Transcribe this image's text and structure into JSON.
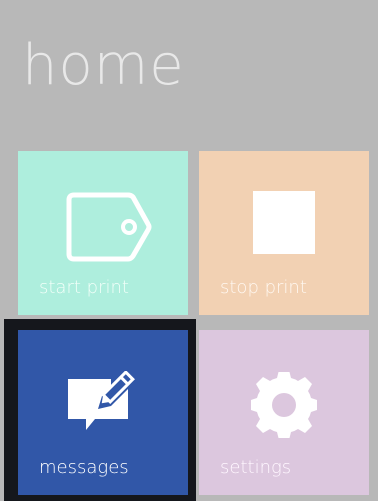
{
  "header": {
    "title": "home"
  },
  "tiles": [
    {
      "id": "start",
      "label": "start print",
      "icon": "tag-icon",
      "background": "#aeeedd"
    },
    {
      "id": "stop",
      "label": "stop print",
      "icon": "stop-square-icon",
      "background": "#f2d1b3"
    },
    {
      "id": "messages",
      "label": "messages",
      "icon": "message-edit-icon",
      "background": "#3157a8"
    },
    {
      "id": "settings",
      "label": "settings",
      "icon": "gear-icon",
      "background": "#dcc7de"
    }
  ],
  "colors": {
    "screen_background": "#b8b8b8",
    "title_text": "#e8e8e8",
    "focus_frame": "#15171c",
    "icon": "#ffffff"
  }
}
